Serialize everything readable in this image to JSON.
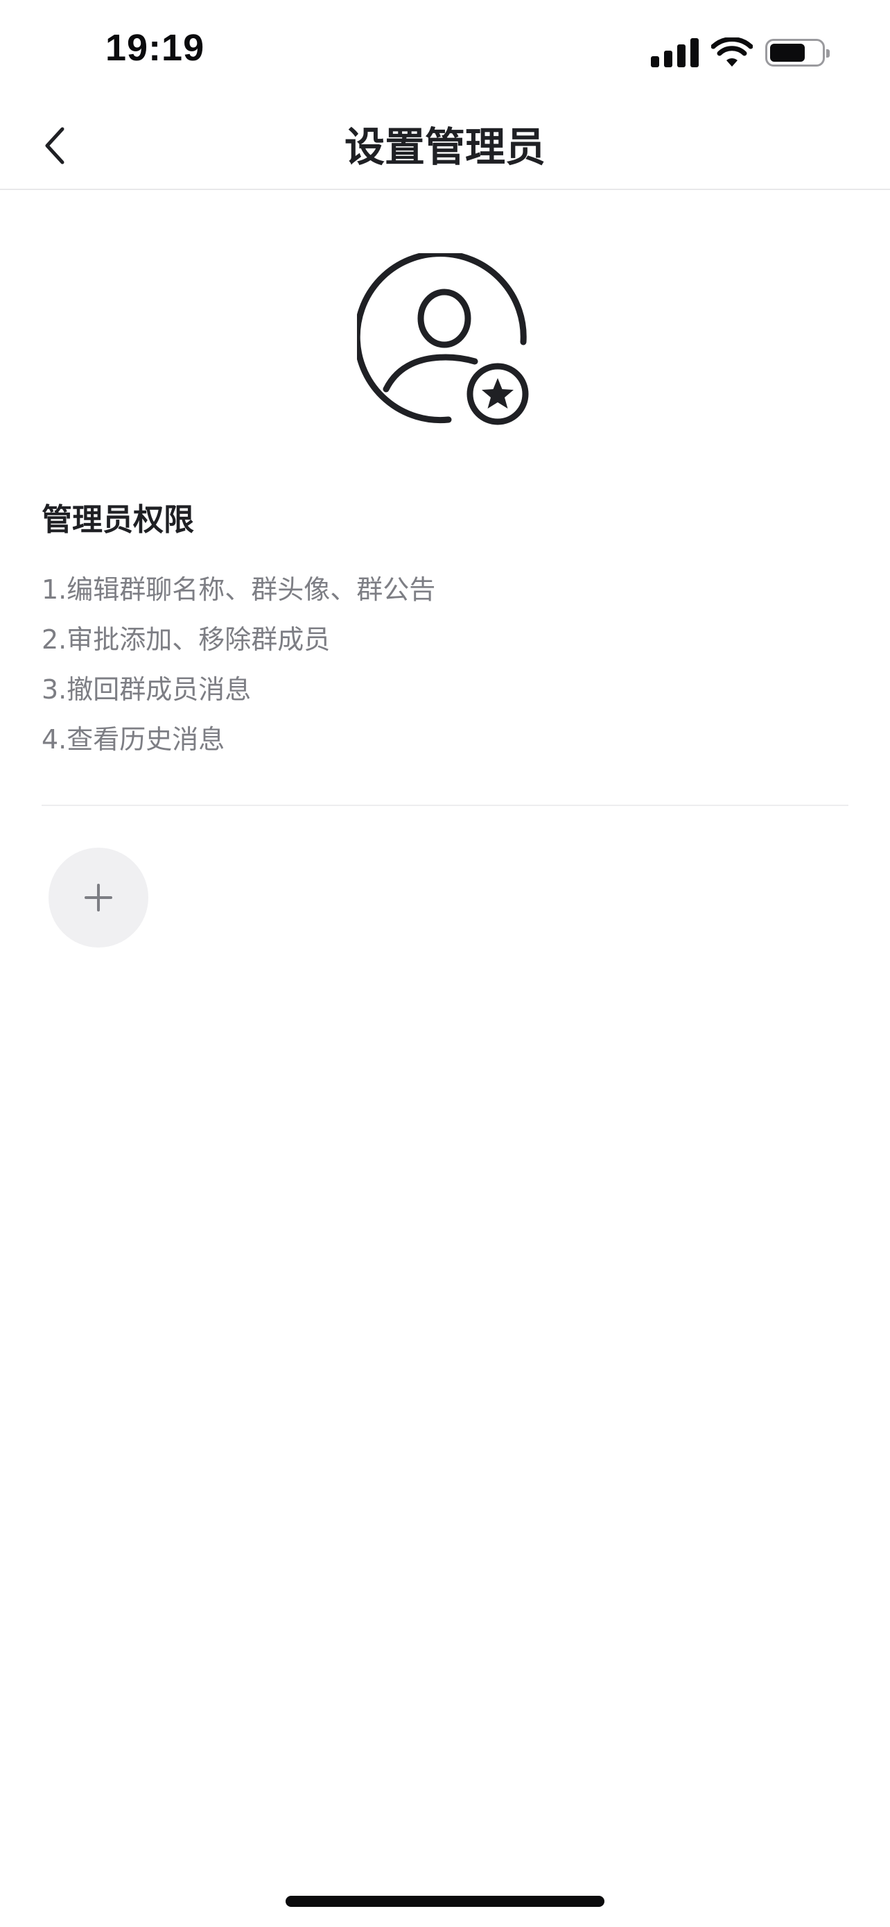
{
  "status_bar": {
    "time": "19:19",
    "signal_bars": 4,
    "battery_level": 0.7,
    "icons": [
      "cellular-signal-icon",
      "wifi-icon",
      "battery-icon"
    ]
  },
  "nav": {
    "title": "设置管理员",
    "back_icon": "chevron-left-icon"
  },
  "hero": {
    "icon": "user-star-icon"
  },
  "permissions": {
    "title": "管理员权限",
    "items": [
      "1.编辑群聊名称、群头像、群公告",
      "2.审批添加、移除群成员",
      "3.撤回群成员消息",
      "4.查看历史消息"
    ]
  },
  "add_button": {
    "icon": "plus-icon"
  },
  "colors": {
    "text_primary": "#1f2024",
    "text_secondary": "#7d7e84",
    "divider": "#ededef",
    "add_button_bg": "#f0f0f2"
  }
}
